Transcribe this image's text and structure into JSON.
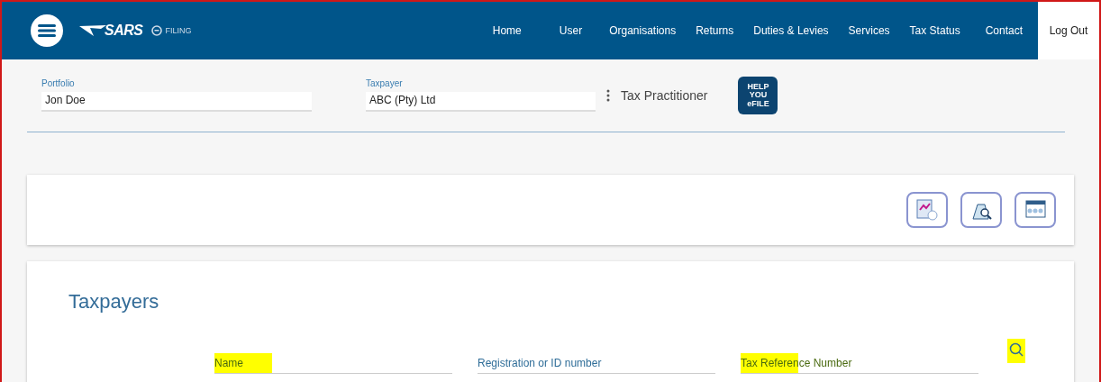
{
  "header": {
    "brand": "SARS",
    "product": "FILING",
    "nav": [
      {
        "label": "Home"
      },
      {
        "label": "User"
      },
      {
        "label": "Organisations"
      },
      {
        "label": "Returns"
      },
      {
        "label": "Duties & Levies"
      },
      {
        "label": "Services"
      },
      {
        "label": "Tax Status"
      },
      {
        "label": "Contact"
      }
    ],
    "logout": "Log Out"
  },
  "context": {
    "portfolio": {
      "label": "Portfolio",
      "value": "Jon Doe"
    },
    "taxpayer": {
      "label": "Taxpayer",
      "value": "ABC (Pty) Ltd"
    },
    "role": "Tax Practitioner",
    "help_badge": [
      "HELP",
      "YOU",
      "eFILE"
    ]
  },
  "search": {
    "title": "Taxpayers",
    "fields": [
      {
        "placeholder": "Name",
        "highlighted": true
      },
      {
        "placeholder": "Registration or ID number",
        "highlighted": false
      },
      {
        "placeholder": "Tax Reference Number",
        "highlighted": true
      }
    ],
    "search_highlighted": true
  }
}
